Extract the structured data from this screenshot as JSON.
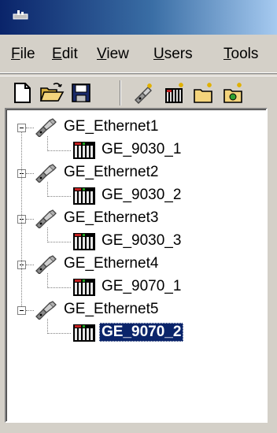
{
  "menubar": {
    "items": [
      {
        "label": "File",
        "key": "F",
        "rest": "ile"
      },
      {
        "label": "Edit",
        "key": "E",
        "rest": "dit"
      },
      {
        "label": "View",
        "key": "V",
        "rest": "iew"
      },
      {
        "label": "Users",
        "key": "U",
        "rest": "sers"
      },
      {
        "label": "Tools",
        "key": "T",
        "rest": "ools"
      }
    ]
  },
  "toolbar": {
    "buttons": [
      "new-file-icon",
      "open-folder-icon",
      "save-disk-icon",
      "new-channel-icon",
      "new-device-icon",
      "new-group-icon",
      "new-tag-icon"
    ]
  },
  "tree": {
    "channels": [
      {
        "label": "GE_Ethernet1",
        "device": "GE_9030_1"
      },
      {
        "label": "GE_Ethernet2",
        "device": "GE_9030_2"
      },
      {
        "label": "GE_Ethernet3",
        "device": "GE_9030_3"
      },
      {
        "label": "GE_Ethernet4",
        "device": "GE_9070_1"
      },
      {
        "label": "GE_Ethernet5",
        "device": "GE_9070_2"
      }
    ],
    "selected": "GE_9070_2"
  },
  "colors": {
    "selection": "#0a246a",
    "face": "#d4d0c8"
  }
}
